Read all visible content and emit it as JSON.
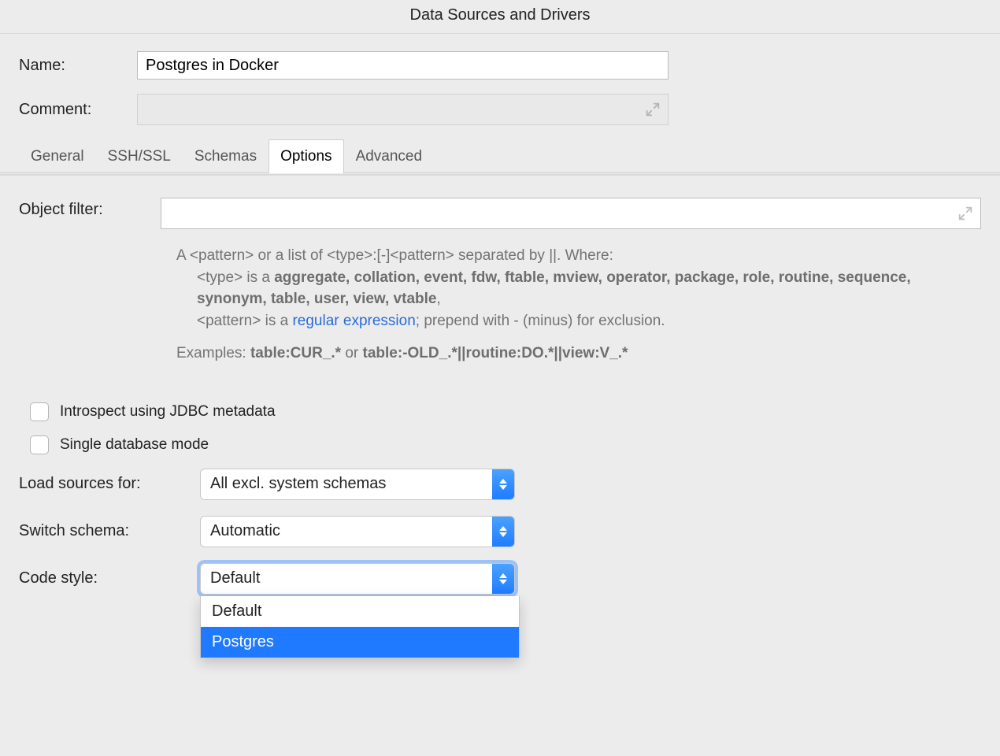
{
  "window": {
    "title": "Data Sources and Drivers"
  },
  "fields": {
    "name_label": "Name:",
    "name_value": "Postgres in Docker",
    "comment_label": "Comment:"
  },
  "tabs": [
    "General",
    "SSH/SSL",
    "Schemas",
    "Options",
    "Advanced"
  ],
  "active_tab": "Options",
  "object_filter": {
    "label": "Object filter:",
    "help_intro": "A <pattern> or a list of <type>:[-]<pattern> separated by ||. Where:",
    "type_line_prefix": "<type> is a ",
    "type_keywords": "aggregate, collation, event, fdw, ftable, mview, operator, package, role, routine, sequence, synonym, table, user, view, vtable",
    "type_line_suffix": ",",
    "pattern_line_prefix": "<pattern> is a ",
    "pattern_link": "regular expression",
    "pattern_line_suffix": "; prepend with - (minus) for exclusion.",
    "examples_prefix": "Examples: ",
    "example1": "table:CUR_.*",
    "examples_or": " or ",
    "example2": "table:-OLD_.*||routine:DO.*||view:V_.*"
  },
  "checks": {
    "introspect": "Introspect using JDBC metadata",
    "single_db": "Single database mode"
  },
  "selects": {
    "load_label": "Load sources for:",
    "load_value": "All excl. system schemas",
    "switch_label": "Switch schema:",
    "switch_value": "Automatic",
    "code_label": "Code style:",
    "code_value": "Default",
    "code_options": [
      "Default",
      "Postgres"
    ],
    "code_highlighted": "Postgres"
  }
}
